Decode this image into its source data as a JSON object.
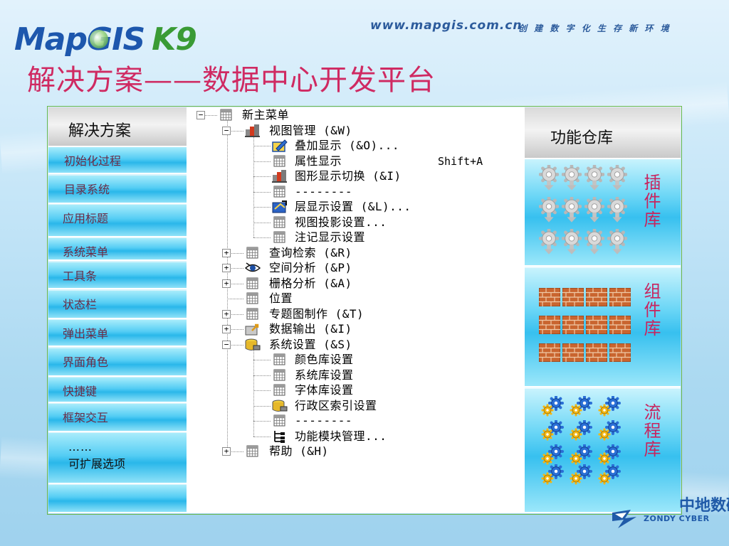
{
  "header": {
    "logo": {
      "map": "Map",
      "g": "G",
      "is": "IS",
      "k9": "K9"
    },
    "url": "www.mapgis.com.cn",
    "slogan": "创 建 数 字 化 生 存 新 环 境",
    "title": "解决方案——数据中心开发平台"
  },
  "solutions": {
    "title": "解决方案",
    "items": [
      {
        "text": "初始化过程"
      },
      {
        "text": "目录系统"
      },
      {
        "text": "应用标题"
      },
      {
        "text": "系统菜单"
      },
      {
        "text": "工具条"
      },
      {
        "text": "状态栏"
      },
      {
        "text": "弹出菜单"
      },
      {
        "text": "界面角色"
      },
      {
        "text": "快捷键"
      },
      {
        "text": "框架交互"
      },
      {
        "text": "……",
        "subtext": "可扩展选项"
      },
      {
        "text": ""
      }
    ]
  },
  "menu_tree": {
    "items": [
      {
        "label": "新主菜单",
        "level": 0,
        "toggle": "-",
        "icon": "grid-icon"
      },
      {
        "label": "视图管理 (&W)",
        "level": 1,
        "toggle": "-",
        "icon": "bars-icon"
      },
      {
        "label": "叠加显示 (&O)...",
        "level": 2,
        "toggle": "",
        "icon": "layer-pencil-icon"
      },
      {
        "label": "属性显示",
        "shortcut": "Shift+A",
        "level": 2,
        "toggle": "",
        "icon": "grid-icon"
      },
      {
        "label": "图形显示切换 (&I)",
        "level": 2,
        "toggle": "",
        "icon": "bars-icon"
      },
      {
        "label": "--------",
        "level": 2,
        "toggle": "",
        "icon": "grid-icon"
      },
      {
        "label": "层显示设置 (&L)...",
        "level": 2,
        "toggle": "",
        "icon": "layer-blue-icon"
      },
      {
        "label": "视图投影设置...",
        "level": 2,
        "toggle": "",
        "icon": "grid-icon"
      },
      {
        "label": "注记显示设置",
        "level": 2,
        "toggle": "",
        "icon": "grid-icon"
      },
      {
        "label": "查询检索 (&R)",
        "level": 1,
        "toggle": "+",
        "icon": "grid-icon"
      },
      {
        "label": "空间分析 (&P)",
        "level": 1,
        "toggle": "+",
        "icon": "eye-icon"
      },
      {
        "label": "栅格分析 (&A)",
        "level": 1,
        "toggle": "+",
        "icon": "grid-icon"
      },
      {
        "label": "位置",
        "level": 1,
        "toggle": "",
        "icon": "grid-icon"
      },
      {
        "label": "专题图制作 (&T)",
        "level": 1,
        "toggle": "+",
        "icon": "grid-icon"
      },
      {
        "label": "数据输出 (&I)",
        "level": 1,
        "toggle": "+",
        "icon": "export-icon"
      },
      {
        "label": "系统设置 (&S)",
        "level": 1,
        "toggle": "-",
        "icon": "database-icon"
      },
      {
        "label": "颜色库设置",
        "level": 2,
        "toggle": "",
        "icon": "grid-icon"
      },
      {
        "label": "系统库设置",
        "level": 2,
        "toggle": "",
        "icon": "grid-icon"
      },
      {
        "label": "字体库设置",
        "level": 2,
        "toggle": "",
        "icon": "grid-icon"
      },
      {
        "label": "行政区索引设置",
        "level": 2,
        "toggle": "",
        "icon": "database-icon"
      },
      {
        "label": "--------",
        "level": 2,
        "toggle": "",
        "icon": "grid-icon"
      },
      {
        "label": "功能模块管理...",
        "level": 2,
        "toggle": "",
        "icon": "module-tree-icon"
      },
      {
        "label": "帮助 (&H)",
        "level": 1,
        "toggle": "+",
        "icon": "grid-icon"
      }
    ]
  },
  "repository": {
    "title": "功能仓库",
    "sections": [
      {
        "label": "插件库",
        "icon": "gear-icon",
        "count": 12
      },
      {
        "label": "组件库",
        "icon": "brick-icon",
        "count": 12
      },
      {
        "label": "流程库",
        "icon": "gear-pair-icon",
        "count": 12
      }
    ]
  },
  "footer_logo": {
    "cn": "中地数码",
    "en": "ZONDY CYBER"
  },
  "colors": {
    "title": "#cf2a62",
    "repo_label": "#c8245e",
    "brand_blue": "#1d57ad",
    "brand_green": "#3a9b35",
    "frame_border": "#6bb84a"
  }
}
